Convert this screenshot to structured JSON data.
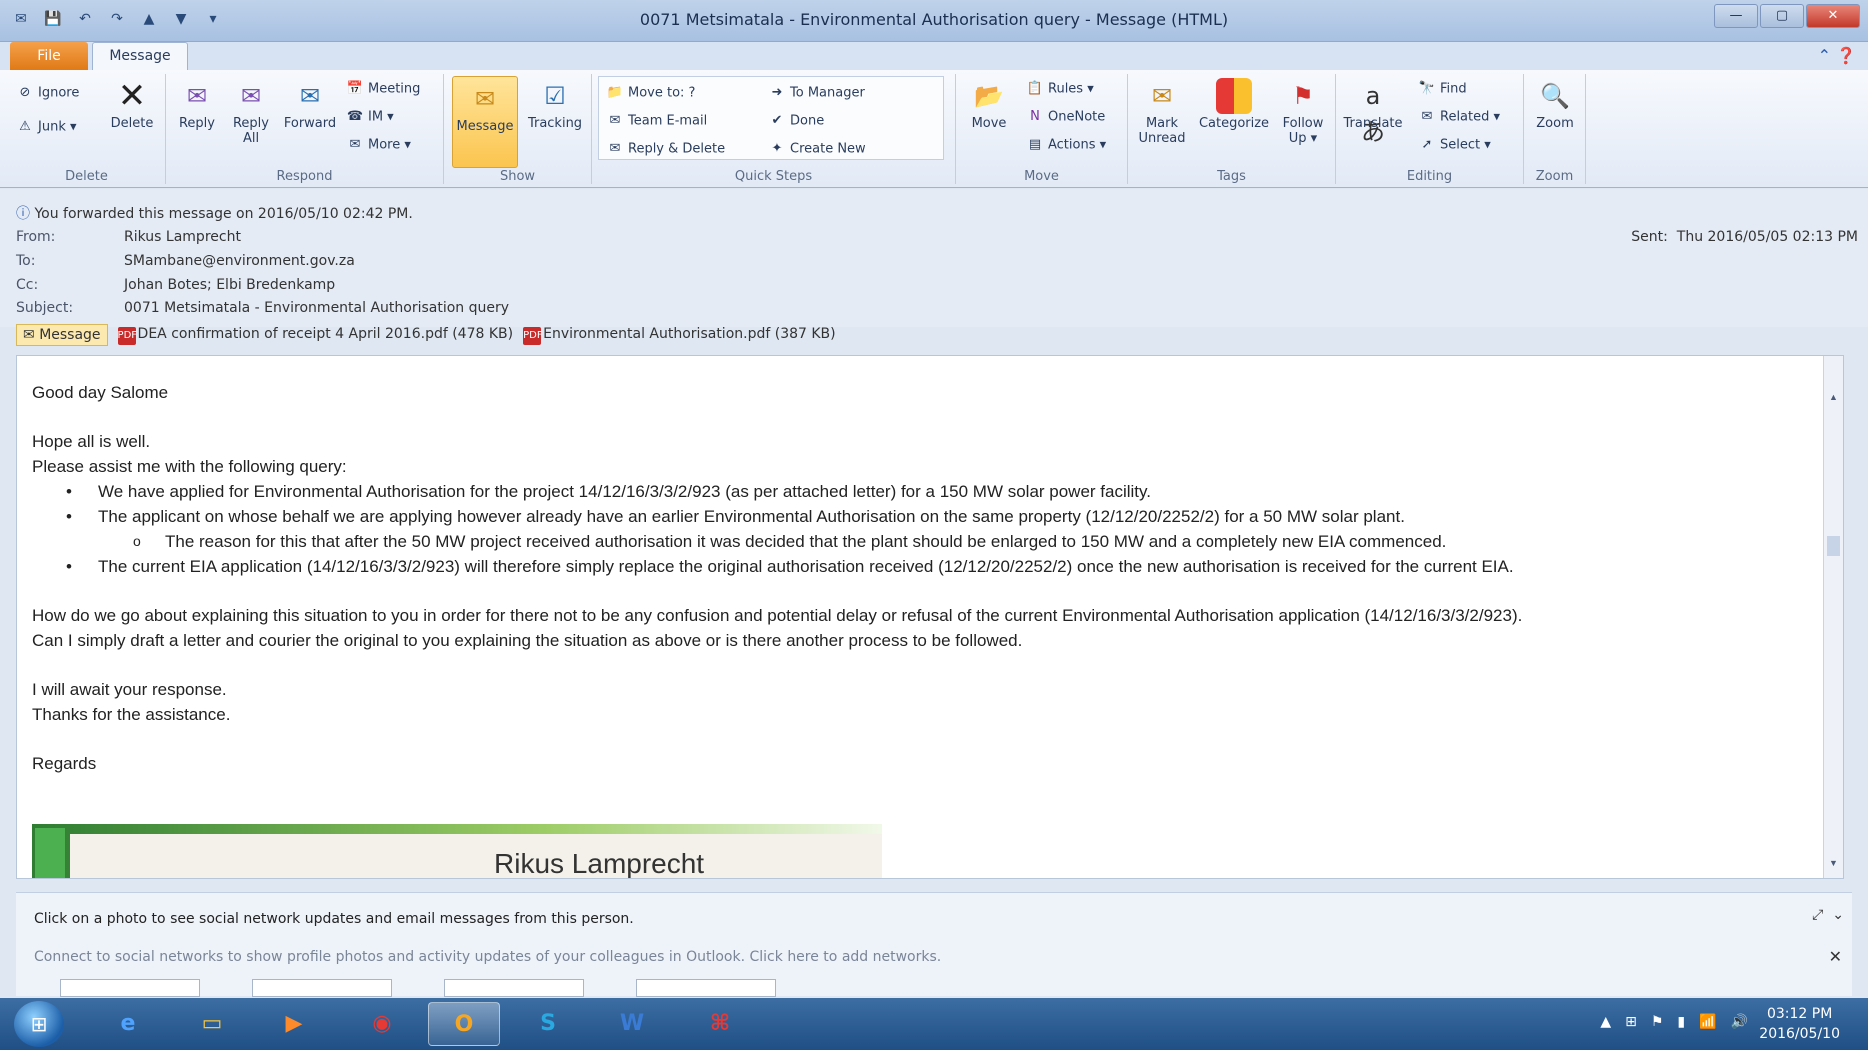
{
  "window": {
    "title": "0071 Metsimatala - Environmental Authorisation query  -  Message (HTML)"
  },
  "tabs": {
    "file": "File",
    "message": "Message"
  },
  "ribbon": {
    "delete_group": {
      "label": "Delete",
      "ignore": "Ignore",
      "junk": "Junk ▾",
      "delete": "Delete"
    },
    "respond_group": {
      "label": "Respond",
      "reply": "Reply",
      "reply_all": "Reply All",
      "forward": "Forward",
      "meeting": "Meeting",
      "im": "IM ▾",
      "more": "More ▾"
    },
    "show_group": {
      "label": "Show",
      "message": "Message",
      "tracking": "Tracking"
    },
    "quick_steps": {
      "label": "Quick Steps",
      "move_to": "Move to: ?",
      "team_email": "Team E-mail",
      "reply_delete": "Reply & Delete",
      "to_manager": "To Manager",
      "done": "Done",
      "create_new": "Create New"
    },
    "move_group": {
      "label": "Move",
      "move": "Move",
      "rules": "Rules ▾",
      "onenote": "OneNote",
      "actions": "Actions ▾"
    },
    "tags_group": {
      "label": "Tags",
      "mark_unread": "Mark Unread",
      "categorize": "Categorize",
      "follow_up": "Follow Up ▾"
    },
    "editing_group": {
      "label": "Editing",
      "translate": "Translate",
      "find": "Find",
      "related": "Related ▾",
      "select": "Select ▾"
    },
    "zoom_group": {
      "label": "Zoom",
      "zoom": "Zoom"
    }
  },
  "header": {
    "forward_note": "You forwarded this message on 2016/05/10 02:42 PM.",
    "from_label": "From:",
    "from": "Rikus Lamprecht",
    "to_label": "To:",
    "to": "SMambane@environment.gov.za",
    "cc_label": "Cc:",
    "cc": "Johan Botes;  Elbi Bredenkamp",
    "subject_label": "Subject:",
    "subject": "0071 Metsimatala - Environmental Authorisation query",
    "sent_label": "Sent:",
    "sent": "Thu 2016/05/05 02:13 PM",
    "attachments": {
      "message_tab": "Message",
      "file1": "DEA confirmation of receipt 4 April 2016.pdf (478 KB)",
      "file2": "Environmental Authorisation.pdf (387 KB)"
    }
  },
  "body": {
    "greeting": "Good day Salome",
    "line1": "Hope all is well.",
    "line2": "Please assist me with the following query:",
    "bullet1": "We have applied for Environmental Authorisation for the project 14/12/16/3/3/2/923 (as per attached letter) for  a 150 MW solar power facility.",
    "bullet2": "The applicant on whose behalf we are applying however already have an earlier Environmental Authorisation on the same property (12/12/20/2252/2) for a 50 MW solar plant.",
    "subbullet": "The reason for this that after the 50 MW project received authorisation it was decided that the plant should be enlarged to 150 MW and a completely new EIA commenced.",
    "bullet3": "The current EIA application (14/12/16/3/3/2/923) will therefore simply replace the original authorisation received (12/12/20/2252/2) once the new authorisation is received for the current EIA.",
    "para1": "How do we go about explaining this situation to you in order for there not to be any confusion and potential delay or refusal of the current Environmental Authorisation application (14/12/16/3/3/2/923).",
    "para2": "Can I simply draft a letter and courier the original to you explaining the situation as above or is there another process to be followed.",
    "closing1": "I will await your response.",
    "closing2": "Thanks for the assistance.",
    "regards": "Regards",
    "signature_name": "Rikus Lamprecht"
  },
  "people_pane": {
    "line1": "Click on a photo to see social network updates and email messages from this person.",
    "line2": "Connect to social networks to show profile photos and activity updates of your colleagues in Outlook. Click here to add networks."
  },
  "taskbar": {
    "time": "03:12 PM",
    "date": "2016/05/10"
  }
}
